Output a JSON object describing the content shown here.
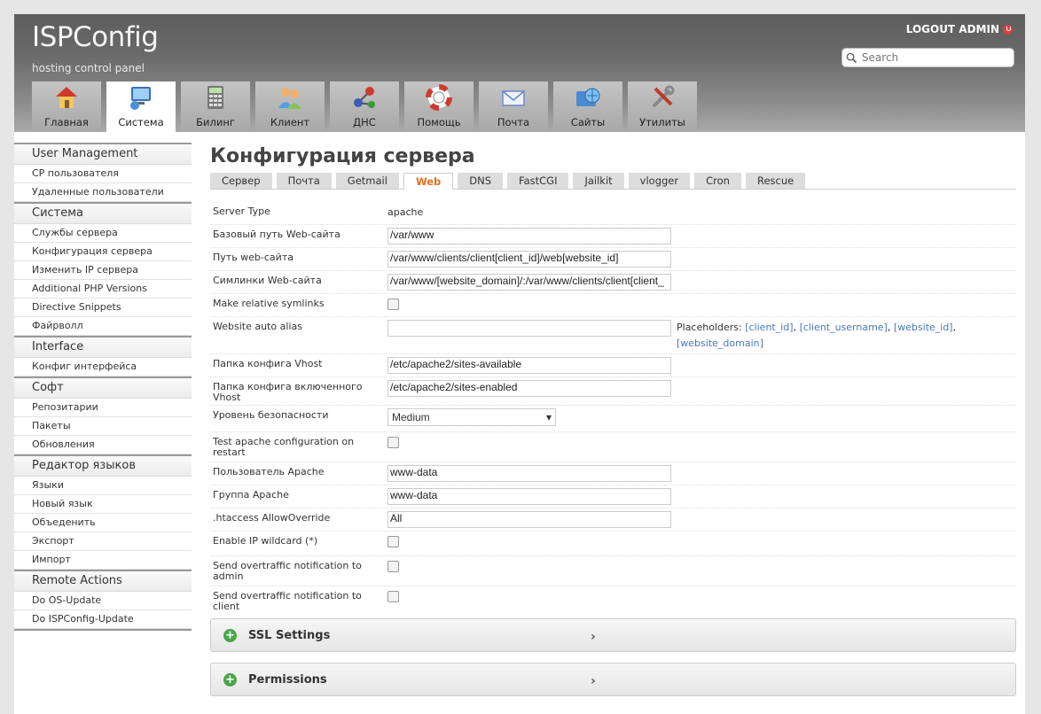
{
  "header": {
    "logo": "ISPConfig",
    "subtitle": "hosting control panel",
    "logout": "LOGOUT ADMIN",
    "search_placeholder": "Search"
  },
  "nav": [
    {
      "label": "Главная",
      "icon": "home-icon"
    },
    {
      "label": "Система",
      "icon": "system-icon",
      "active": true
    },
    {
      "label": "Билинг",
      "icon": "calculator-icon"
    },
    {
      "label": "Клиент",
      "icon": "users-icon"
    },
    {
      "label": "ДНС",
      "icon": "dns-network-icon"
    },
    {
      "label": "Помощь",
      "icon": "lifebuoy-icon"
    },
    {
      "label": "Почта",
      "icon": "mail-icon"
    },
    {
      "label": "Сайты",
      "icon": "globe-folder-icon"
    },
    {
      "label": "Утилиты",
      "icon": "tools-icon"
    }
  ],
  "sidebar": [
    {
      "title": "User Management",
      "items": [
        "CP пользователя",
        "Удаленные пользователи"
      ]
    },
    {
      "title": "Система",
      "items": [
        "Службы сервера",
        "Конфигурация сервера",
        "Изменить IP сервера",
        "Additional PHP Versions",
        "Directive Snippets",
        "Файрволл"
      ]
    },
    {
      "title": "Interface",
      "items": [
        "Конфиг интерфейса"
      ]
    },
    {
      "title": "Софт",
      "items": [
        "Репозитарии",
        "Пакеты",
        "Обновления"
      ]
    },
    {
      "title": "Редактор языков",
      "items": [
        "Языки",
        "Новый язык",
        "Объеденить",
        "Экспорт",
        "Импорт"
      ]
    },
    {
      "title": "Remote Actions",
      "items": [
        "Do OS-Update",
        "Do ISPConfig-Update"
      ]
    }
  ],
  "main": {
    "title": "Конфигурация сервера",
    "tabs": [
      "Сервер",
      "Почта",
      "Getmail",
      "Web",
      "DNS",
      "FastCGI",
      "Jailkit",
      "vlogger",
      "Cron",
      "Rescue"
    ],
    "active_tab": "Web",
    "form": {
      "server_type_label": "Server Type",
      "server_type_value": "apache",
      "base_path_label": "Базовый путь Web-сайта",
      "base_path_value": "/var/www",
      "site_path_label": "Путь web-сайта",
      "site_path_value": "/var/www/clients/client[client_id]/web[website_id]",
      "symlinks_label": "Симлинки Web-сайта",
      "symlinks_value": "/var/www/[website_domain]/:/var/www/clients/client[client_",
      "relative_symlinks_label": "Make relative symlinks",
      "auto_alias_label": "Website auto alias",
      "auto_alias_value": "",
      "placeholders_label": "Placeholders:",
      "ph_client_id": "[client_id]",
      "ph_client_username": "[client_username]",
      "ph_website_id": "[website_id]",
      "ph_website_domain": "[website_domain]",
      "vhost_dir_label": "Папка конфига Vhost",
      "vhost_dir_value": "/etc/apache2/sites-available",
      "vhost_enabled_label": "Папка конфига включенного Vhost",
      "vhost_enabled_value": "/etc/apache2/sites-enabled",
      "security_label": "Уровень безопасности",
      "security_value": "Medium",
      "test_apache_label": "Test apache configuration on restart",
      "apache_user_label": "Пользователь Apache",
      "apache_user_value": "www-data",
      "apache_group_label": "Группа Apache",
      "apache_group_value": "www-data",
      "htaccess_label": ".htaccess AllowOverride",
      "htaccess_value": "All",
      "ip_wildcard_label": "Enable IP wildcard (*)",
      "overtraffic_admin_label": "Send overtraffic notification to admin",
      "overtraffic_client_label": "Send overtraffic notification to client"
    },
    "sections": [
      "SSL Settings",
      "Permissions"
    ]
  }
}
